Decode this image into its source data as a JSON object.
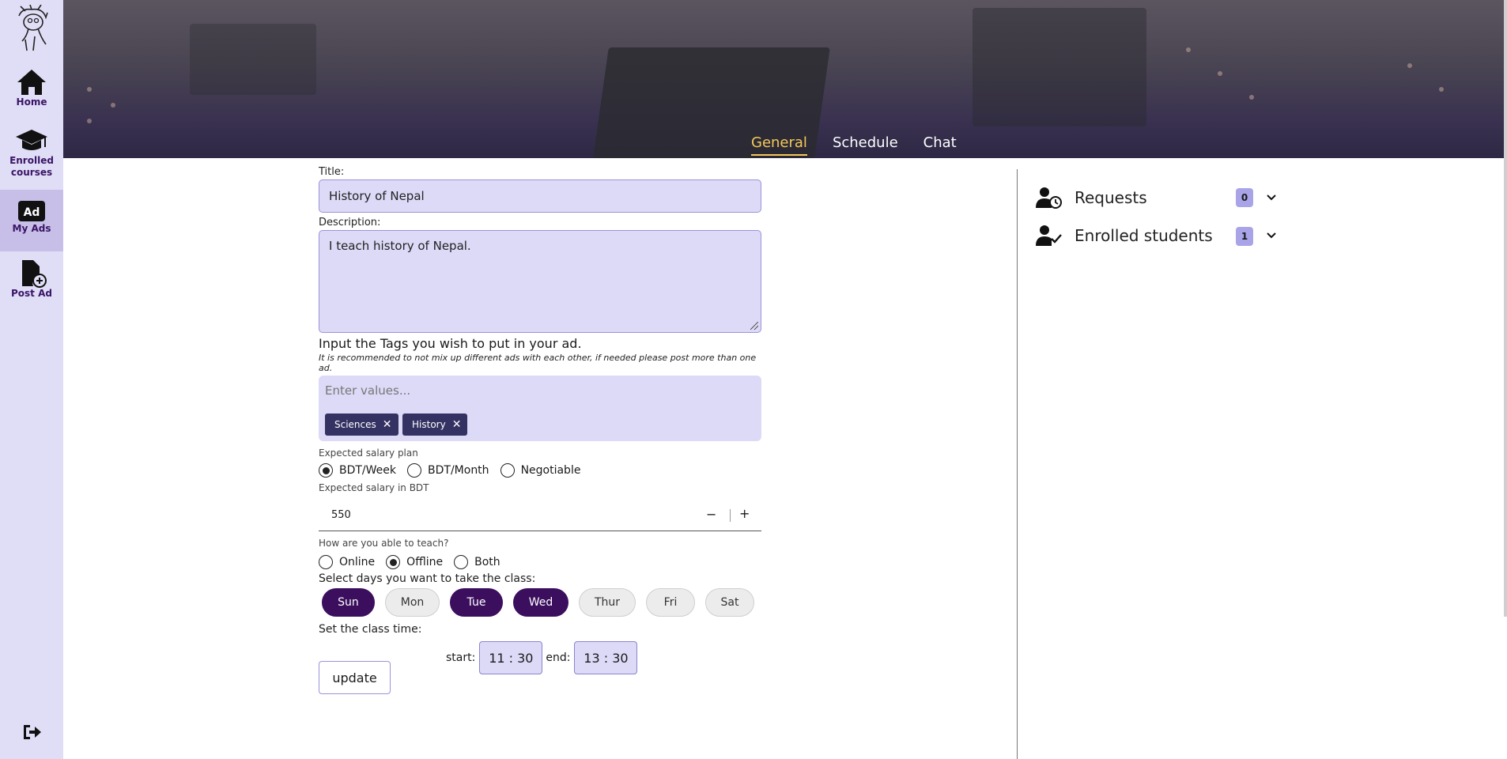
{
  "sidebar": {
    "items": [
      {
        "label": "Home",
        "icon": "home-icon"
      },
      {
        "label": "Enrolled courses",
        "icon": "graduation-cap-icon"
      },
      {
        "label": "My Ads",
        "icon": "ad-icon",
        "active": true
      },
      {
        "label": "Post Ad",
        "icon": "file-plus-icon"
      }
    ]
  },
  "tabs": [
    {
      "label": "General",
      "active": true
    },
    {
      "label": "Schedule"
    },
    {
      "label": "Chat"
    }
  ],
  "form": {
    "title_label": "Title:",
    "title_value": "History of Nepal",
    "description_label": "Description:",
    "description_value": "I teach history of Nepal.",
    "tags_label": "Input the Tags you wish to put in your ad.",
    "tags_hint": "It is recommended to not mix up different ads with each other, if needed please post more than one ad.",
    "tags_placeholder": "Enter values...",
    "tags": [
      "Sciences",
      "History"
    ],
    "salary_plan_label": "Expected salary plan",
    "salary_plans": [
      {
        "label": "BDT/Week",
        "selected": true
      },
      {
        "label": "BDT/Month",
        "selected": false
      },
      {
        "label": "Negotiable",
        "selected": false
      }
    ],
    "salary_label": "Expected salary in BDT",
    "salary_value": "550",
    "stepper_minus": "−",
    "stepper_plus": "+",
    "teach_mode_label": "How are you able to teach?",
    "teach_modes": [
      {
        "label": "Online",
        "selected": false
      },
      {
        "label": "Offline",
        "selected": true
      },
      {
        "label": "Both",
        "selected": false
      }
    ],
    "days_label": "Select days you want to take the class:",
    "days": [
      {
        "label": "Sun",
        "selected": true
      },
      {
        "label": "Mon",
        "selected": false
      },
      {
        "label": "Tue",
        "selected": true
      },
      {
        "label": "Wed",
        "selected": true
      },
      {
        "label": "Thur",
        "selected": false
      },
      {
        "label": "Fri",
        "selected": false
      },
      {
        "label": "Sat",
        "selected": false
      }
    ],
    "time_label": "Set the class time:",
    "start_label": "start:",
    "start_value": "11 : 30",
    "end_label": "end:",
    "end_value": "13 : 30",
    "update_label": "update"
  },
  "panel": {
    "requests_label": "Requests",
    "requests_count": "0",
    "enrolled_label": "Enrolled students",
    "enrolled_count": "1"
  },
  "colors": {
    "accent": "#3b0f5e",
    "sidebar_bg": "#e0def6",
    "field_bg": "#dcdaf7",
    "active_tab": "#f4c85a"
  }
}
